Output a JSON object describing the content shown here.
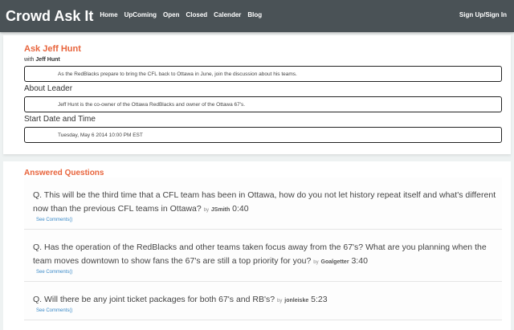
{
  "nav": {
    "brand": "Crowd Ask It",
    "links": [
      "Home",
      "UpComing",
      "Open",
      "Closed",
      "Calender",
      "Blog"
    ],
    "signin": "Sign Up/Sign In"
  },
  "session": {
    "title": "Ask Jeff Hunt",
    "with_prefix": "with",
    "with_name": "Jeff Hunt",
    "description": "As the RedBlacks prepare to bring the CFL back to Ottawa in June, join the discussion about his teams.",
    "about_label": "About Leader",
    "about": "Jeff Hunt is the co-owner of the Ottawa RedBlacks and owner of the Ottawa 67's.",
    "date_label": "Start Date and Time",
    "date": "Tuesday, May 6 2014 10:00 PM EST"
  },
  "answered": {
    "heading": "Answered Questions",
    "by": "by",
    "questions": [
      {
        "text": "Q. This will be the third time that a CFL team has been in Ottawa, how do you not let history repeat itself and what's different now than the previous CFL teams in Ottawa?",
        "user": "JSmith",
        "time": "0:40",
        "comments": "See Comments()"
      },
      {
        "text": "Q. Has the operation of the RedBlacks and other teams taken focus away from the 67's? What are you planning when the team moves downtown to show fans the 67's are still a top priority for you?",
        "user": "Goalgetter",
        "time": "3:40",
        "comments": "See Comments()"
      },
      {
        "text": "Q. Will there be any joint ticket packages for both 67's and RB's?",
        "user": "jonleiske",
        "time": "5:23",
        "comments": "See Comments()"
      }
    ]
  }
}
